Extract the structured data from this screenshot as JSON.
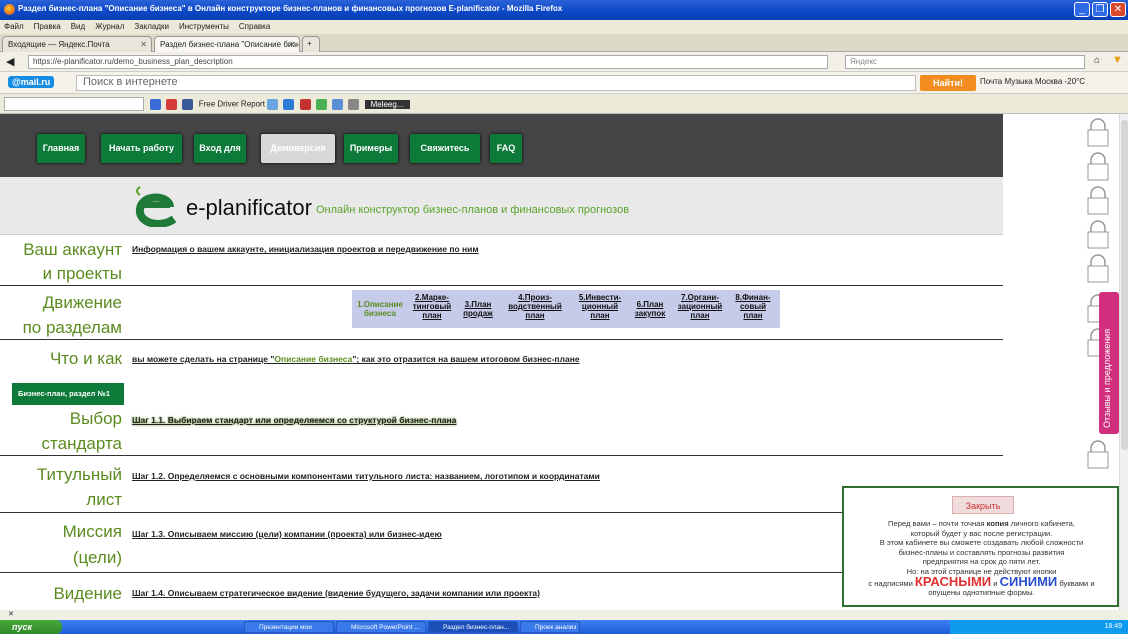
{
  "window": {
    "title": "Раздел бизнес-плана \"Описание бизнеса\" в Онлайн конструкторе бизнес-планов и финансовых прогнозов E-planificator - Mozilla Firefox"
  },
  "menu": [
    "Файл",
    "Правка",
    "Вид",
    "Журнал",
    "Закладки",
    "Инструменты",
    "Справка"
  ],
  "tabs": [
    {
      "label": "Входящие — Яндекс.Почта"
    },
    {
      "label": "Раздел бизнес-плана \"Описание бизне..."
    }
  ],
  "nav": {
    "url": "https://e-planificator.ru/demo_business_plan_description",
    "search_placeholder": "Яндекс"
  },
  "mailru": {
    "logo": "@mail.ru",
    "search_placeholder": "Поиск в интернете",
    "find": "Найти!",
    "links": "Почта   Музыка   Москва -20°C"
  },
  "toolbar": {
    "free_driver": "Free Driver Report",
    "meleeg": "Meleeg..."
  },
  "site": {
    "nav": [
      "Главная",
      "Начать работу",
      "Вход для",
      "Демоверсия",
      "Примеры",
      "Свяжитесь",
      "FAQ"
    ],
    "brand": "e-planificator",
    "slogan": "Онлайн конструктор бизнес-планов и финансовых прогнозов",
    "rows": [
      {
        "label1": "Ваш аккаунт",
        "label2": "и проекты",
        "desc": "Информация о вашем аккаунте, инициализация проектов и передвижение по ним"
      },
      {
        "label1": "Движение",
        "label2": "по разделам"
      },
      {
        "label1": "Что и как",
        "desc_pre": "вы можете сделать на странице \"",
        "desc_link": "Описание бизнеса",
        "desc_post": "\"; как это отразится на вашем итоговом бизнес-плане"
      },
      {
        "label1": "Выбор",
        "label2": "стандарта",
        "desc": "Шаг 1.1. Выбираем стандарт или определяемся со структурой бизнес-плана"
      },
      {
        "label1": "Титульный",
        "label2": "лист",
        "desc": "Шаг 1.2. Определяемся с основными компонентами титульного листа: названием, логотипом и координатами"
      },
      {
        "label1": "Миссия",
        "label2": "(цели)",
        "desc": "Шаг 1.3. Описываем миссию (цели) компании (проекта) или бизнес-идею"
      },
      {
        "label1": "Видение",
        "desc": "Шаг 1.4. Описываем стратегическое видение (видение будущего, задачи компании или проекта)"
      }
    ],
    "steps": [
      {
        "l1": "1.Описание",
        "l2": "бизнеса",
        "l3": ""
      },
      {
        "l1": "2.Марке-",
        "l2": "тинговый",
        "l3": "план"
      },
      {
        "l1": "3.План",
        "l2": "продаж",
        "l3": ""
      },
      {
        "l1": "4.Произ-",
        "l2": "водственный",
        "l3": "план"
      },
      {
        "l1": "5.Инвести-",
        "l2": "ционный",
        "l3": "план"
      },
      {
        "l1": "6.План",
        "l2": "закупок",
        "l3": ""
      },
      {
        "l1": "7.Органи-",
        "l2": "зационный",
        "l3": "план"
      },
      {
        "l1": "8.Финан-",
        "l2": "совый",
        "l3": "план"
      }
    ],
    "badge": "Бизнес-план, раздел №1",
    "feedback": "Отзывы и предложения"
  },
  "popup": {
    "close": "Закрыть",
    "line1a": "Перед вами – почти точная ",
    "line1b": "копия",
    "line1c": " личного кабинета,",
    "line2": "который будет у вас после регистрации.",
    "line3": "В этом кабинете вы сможете создавать любой сложности",
    "line4": "бизнес-планы и составлять прогнозы развития",
    "line5": "предприятия на срок до пяти лет.",
    "line6": "Но: на этой странице не действуют кнопки",
    "line7a": "с надписями ",
    "red": "КРАСНЫМИ",
    "and": " и ",
    "blue": "СИНИМИ",
    "line7b": " буквами и",
    "line8": "опущены однотипные формы."
  },
  "taskbar": {
    "start": "пуск",
    "tasks": [
      "Презентации мои",
      "Microsoft PowerPoint ...",
      "Раздел бизнес-план...",
      "Проек анализ"
    ],
    "clock": "18:49"
  },
  "colors": {
    "accent_green": "#0d7a3a",
    "label_green": "#5b8b1f",
    "feedback_pink": "#cf2f7d",
    "xp_blue": "#0b46c4"
  }
}
